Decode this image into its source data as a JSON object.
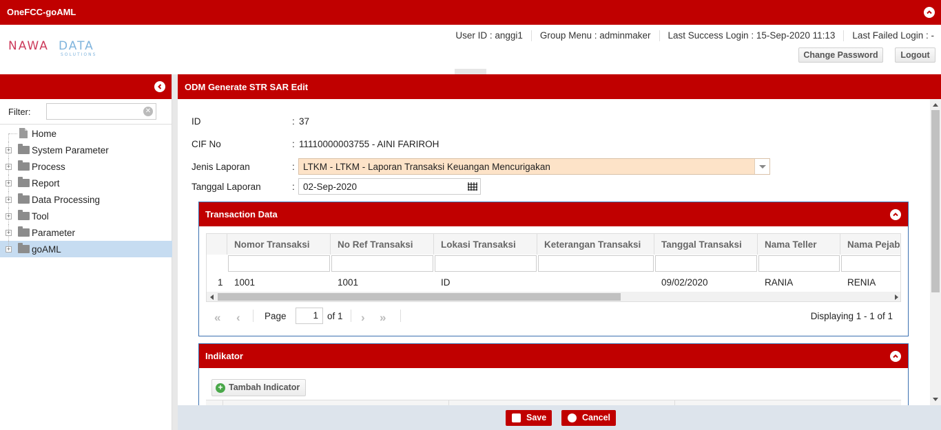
{
  "app": {
    "title": "OneFCC-goAML",
    "logo_text": "NAWADATA",
    "logo_subtext": "SOLUTIONS"
  },
  "header": {
    "user_id": "User ID : anggi1",
    "group_menu": "Group Menu : adminmaker",
    "last_success": "Last Success Login : 15-Sep-2020 11:13",
    "last_failed": "Last Failed Login : -",
    "change_password_label": "Change Password",
    "logout_label": "Logout"
  },
  "sidebar": {
    "filter_label": "Filter:",
    "filter_value": "",
    "items": [
      {
        "label": "Home"
      },
      {
        "label": "System Parameter"
      },
      {
        "label": "Process"
      },
      {
        "label": "Report"
      },
      {
        "label": "Data Processing"
      },
      {
        "label": "Tool"
      },
      {
        "label": "Parameter"
      },
      {
        "label": "goAML"
      }
    ]
  },
  "main": {
    "title": "ODM Generate STR SAR Edit",
    "form": {
      "id_label": "ID",
      "id_value": "37",
      "cif_label": "CIF No",
      "cif_value": "11110000003755 - AINI FARIROH",
      "jenis_label": "Jenis Laporan",
      "jenis_value": "LTKM - LTKM - Laporan Transaksi Keuangan Mencurigakan",
      "tanggal_label": "Tanggal Laporan",
      "tanggal_value": "02-Sep-2020",
      "colon": ":"
    },
    "transaction_panel": {
      "title": "Transaction Data",
      "columns": [
        "Nomor Transaksi",
        "No Ref Transaksi",
        "Lokasi Transaksi",
        "Keterangan Transaksi",
        "Tanggal Transaksi",
        "Nama Teller",
        "Nama Pejaba"
      ],
      "rows": [
        {
          "num": "1",
          "cells": [
            "1001",
            "1001",
            "ID",
            "",
            "09/02/2020",
            "RANIA",
            "RENIA"
          ]
        }
      ],
      "pager": {
        "page_label": "Page",
        "page_value": "1",
        "of_label": "of 1",
        "displaying": "Displaying 1 - 1 of 1"
      }
    },
    "indikator_panel": {
      "title": "Indikator",
      "add_button": "Tambah Indicator"
    }
  },
  "footer": {
    "save_label": "Save",
    "cancel_label": "Cancel"
  },
  "colors": {
    "brand_red": "#c00000",
    "selected_row": "#c6dcf1",
    "combo_highlight": "#fde3c8"
  }
}
